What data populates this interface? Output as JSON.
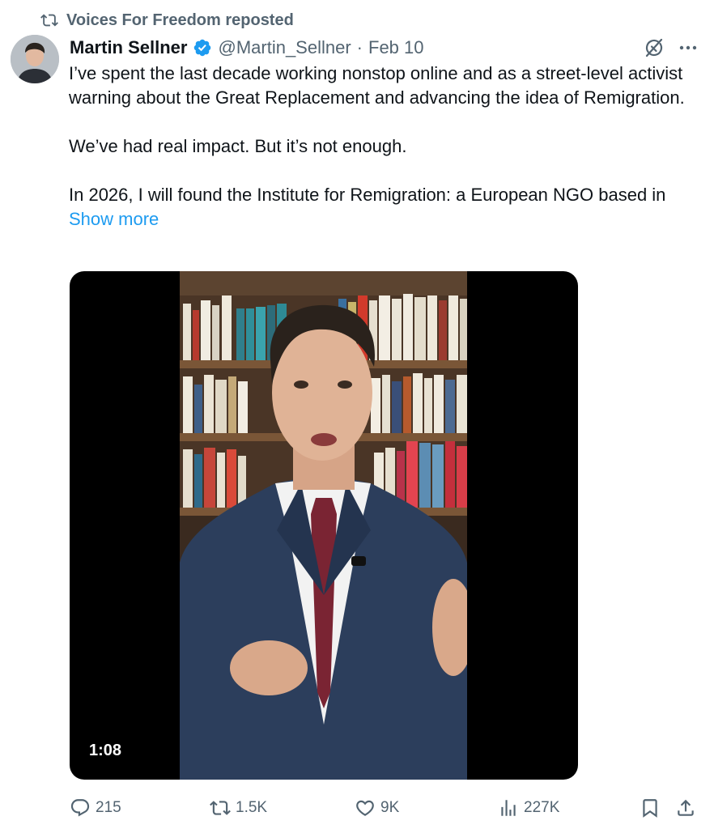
{
  "repost": {
    "text": "Voices For Freedom reposted",
    "icon": "repost-icon"
  },
  "author": {
    "name": "Martin Sellner",
    "handle": "@Martin_Sellner",
    "separator": "·",
    "date": "Feb 10",
    "verified_color": "#1d9bf0"
  },
  "body": {
    "line1": "I’ve spent the last decade working nonstop online and as a street-level activist warning about the Great Replacement and advancing the idea of Remigration.",
    "line2": "We’ve had real impact. But it’s not enough.",
    "line3": "In 2026, I will found the Institute for Remigration: a European NGO based in",
    "show_more": "Show more"
  },
  "media": {
    "duration": "1:08"
  },
  "actions": {
    "replies": "215",
    "reposts": "1.5K",
    "likes": "9K",
    "views": "227K"
  },
  "colors": {
    "accent": "#1d9bf0",
    "muted": "#536471",
    "text": "#0f1419"
  }
}
